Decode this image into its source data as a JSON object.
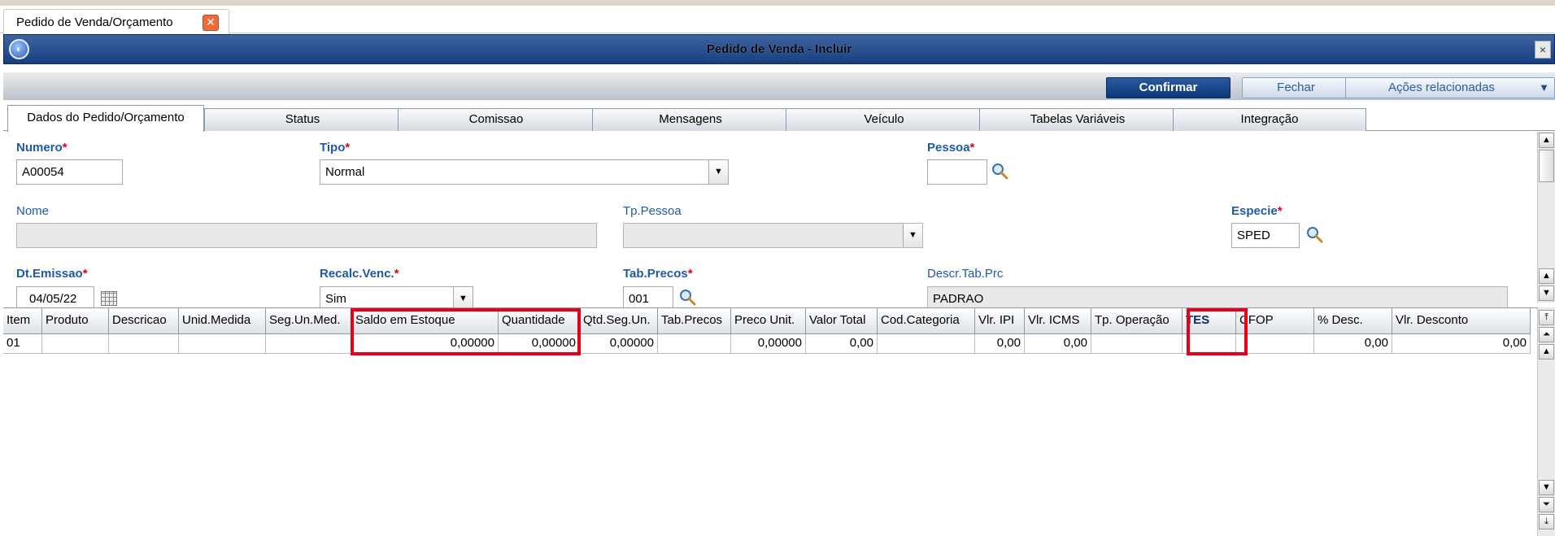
{
  "doc_tab": {
    "label": "Pedido de Venda/Orçamento",
    "close": "✕"
  },
  "window": {
    "title": "Pedido de Venda - Incluir",
    "close": "×"
  },
  "actions": {
    "confirm": "Confirmar",
    "close": "Fechar",
    "related": "Ações relacionadas"
  },
  "tabs": [
    "Dados do Pedido/Orçamento",
    "Status",
    "Comissao",
    "Mensagens",
    "Veículo",
    "Tabelas Variáveis",
    "Integração"
  ],
  "form": {
    "numero": {
      "label": "Numero",
      "value": "A00054"
    },
    "tipo": {
      "label": "Tipo",
      "value": "Normal"
    },
    "pessoa": {
      "label": "Pessoa",
      "value": ""
    },
    "nome": {
      "label": "Nome",
      "value": ""
    },
    "tp_pessoa": {
      "label": "Tp.Pessoa",
      "value": ""
    },
    "especie": {
      "label": "Especie",
      "value": "SPED"
    },
    "dt_emissao": {
      "label": "Dt.Emissao",
      "value": "04/05/22"
    },
    "recalc_venc": {
      "label": "Recalc.Venc.",
      "value": "Sim"
    },
    "tab_precos": {
      "label": "Tab.Precos",
      "value": "001"
    },
    "descr_tab_prc": {
      "label": "Descr.Tab.Prc",
      "value": "PADRAO"
    },
    "required_mark": "*"
  },
  "grid": {
    "columns": [
      "Item",
      "Produto",
      "Descricao",
      "Unid.Medida",
      "Seg.Un.Med.",
      "Saldo em Estoque",
      "Quantidade",
      "Qtd.Seg.Un.",
      "Tab.Precos",
      "Preco Unit.",
      "Valor Total",
      "Cod.Categoria",
      "Vlr. IPI",
      "Vlr. ICMS",
      "Tp. Operação",
      "TES",
      "CFOP",
      "% Desc.",
      "Vlr. Desconto"
    ],
    "rows": [
      [
        "01",
        "",
        "",
        "",
        "",
        "0,00000",
        "0,00000",
        "0,00000",
        "",
        "0,00000",
        "0,00",
        "",
        "0,00",
        "0,00",
        "",
        "",
        "",
        "0,00",
        "0,00"
      ]
    ]
  },
  "colors": {
    "accent": "#173f80",
    "highlight": "#e8001b",
    "label": "#1f5aa6",
    "required": "#e0001b"
  }
}
